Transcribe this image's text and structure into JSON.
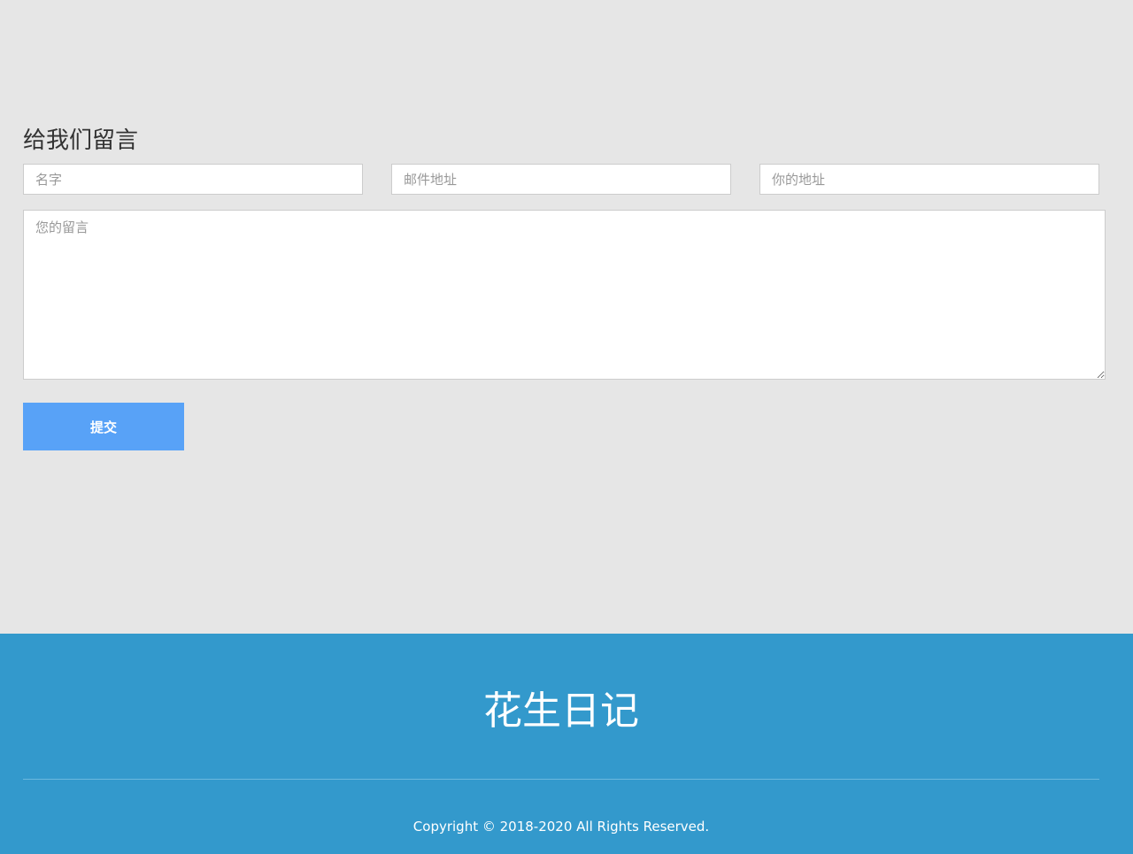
{
  "contact": {
    "title": "给我们留言",
    "name_placeholder": "名字",
    "email_placeholder": "邮件地址",
    "address_placeholder": "你的地址",
    "message_placeholder": "您的留言",
    "submit_label": "提交"
  },
  "footer": {
    "brand": "花生日记",
    "copyright": "Copyright © 2018-2020 All Rights Reserved."
  },
  "colors": {
    "page_background": "#e6e6e6",
    "submit_button": "#58a2f7",
    "footer_background": "#3399cc"
  }
}
